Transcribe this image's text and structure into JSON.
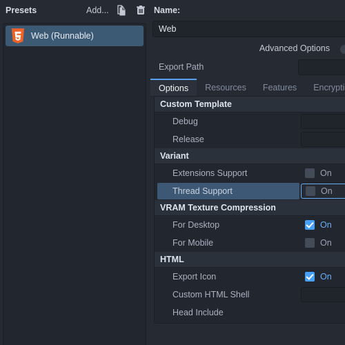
{
  "left_panel": {
    "title": "Presets",
    "add_label": "Add...",
    "duplicate_icon": "duplicate-icon",
    "delete_icon": "trash-icon",
    "items": [
      {
        "label": "Web (Runnable)",
        "icon": "html5-logo-icon",
        "selected": true
      }
    ]
  },
  "right_panel": {
    "name_label": "Name:",
    "name_value": "Web",
    "advanced_options_label": "Advanced Options",
    "export_path_label": "Export Path",
    "export_path_value": "",
    "tabs": [
      {
        "label": "Options",
        "active": true
      },
      {
        "label": "Resources",
        "active": false
      },
      {
        "label": "Features",
        "active": false
      },
      {
        "label": "Encryption",
        "active": false
      }
    ],
    "sections": [
      {
        "title": "Custom Template",
        "rows": [
          {
            "label": "Debug",
            "kind": "text",
            "value": ""
          },
          {
            "label": "Release",
            "kind": "text",
            "value": ""
          }
        ]
      },
      {
        "title": "Variant",
        "rows": [
          {
            "label": "Extensions Support",
            "kind": "checkbox",
            "checked": false,
            "value_text": "On",
            "focused": false,
            "highlighted": false
          },
          {
            "label": "Thread Support",
            "kind": "checkbox",
            "checked": false,
            "value_text": "On",
            "focused": true,
            "highlighted": true
          }
        ]
      },
      {
        "title": "VRAM Texture Compression",
        "rows": [
          {
            "label": "For Desktop",
            "kind": "checkbox",
            "checked": true,
            "value_text": "On",
            "focused": false,
            "highlighted": false
          },
          {
            "label": "For Mobile",
            "kind": "checkbox",
            "checked": false,
            "value_text": "On",
            "focused": false,
            "highlighted": false
          }
        ]
      },
      {
        "title": "HTML",
        "rows": [
          {
            "label": "Export Icon",
            "kind": "checkbox",
            "checked": true,
            "value_text": "On",
            "focused": false,
            "highlighted": false
          },
          {
            "label": "Custom HTML Shell",
            "kind": "text",
            "value": ""
          },
          {
            "label": "Head Include",
            "kind": "textarea",
            "value": ""
          }
        ]
      }
    ]
  },
  "colors": {
    "accent": "#47a0f5",
    "selection": "#3d5a75",
    "panel_bg": "#22272f",
    "window_bg": "#262b33",
    "html5_orange": "#e8622a"
  }
}
